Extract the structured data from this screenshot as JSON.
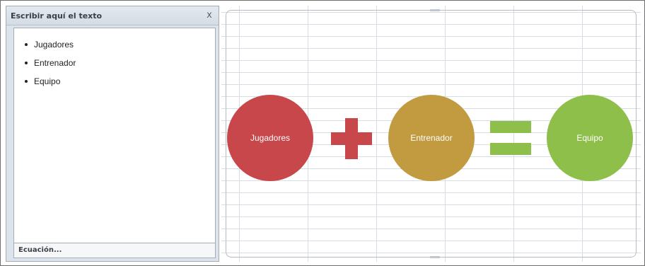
{
  "text_pane": {
    "title": "Escribir aquí el texto",
    "close_glyph": "x",
    "items": [
      {
        "label": "Jugadores"
      },
      {
        "label": "Entrenador"
      },
      {
        "label": "Equipo"
      }
    ],
    "footer_link": "Ecuación..."
  },
  "diagram": {
    "nodes": [
      {
        "label": "Jugadores",
        "color": "#c8474a"
      },
      {
        "label": "Entrenador",
        "color": "#c29a3f"
      },
      {
        "label": "Equipo",
        "color": "#8fbf4b"
      }
    ],
    "operators": [
      {
        "name": "plus-icon",
        "color": "#c8474a"
      },
      {
        "name": "equals-icon",
        "color": "#8fbf4b"
      }
    ]
  }
}
